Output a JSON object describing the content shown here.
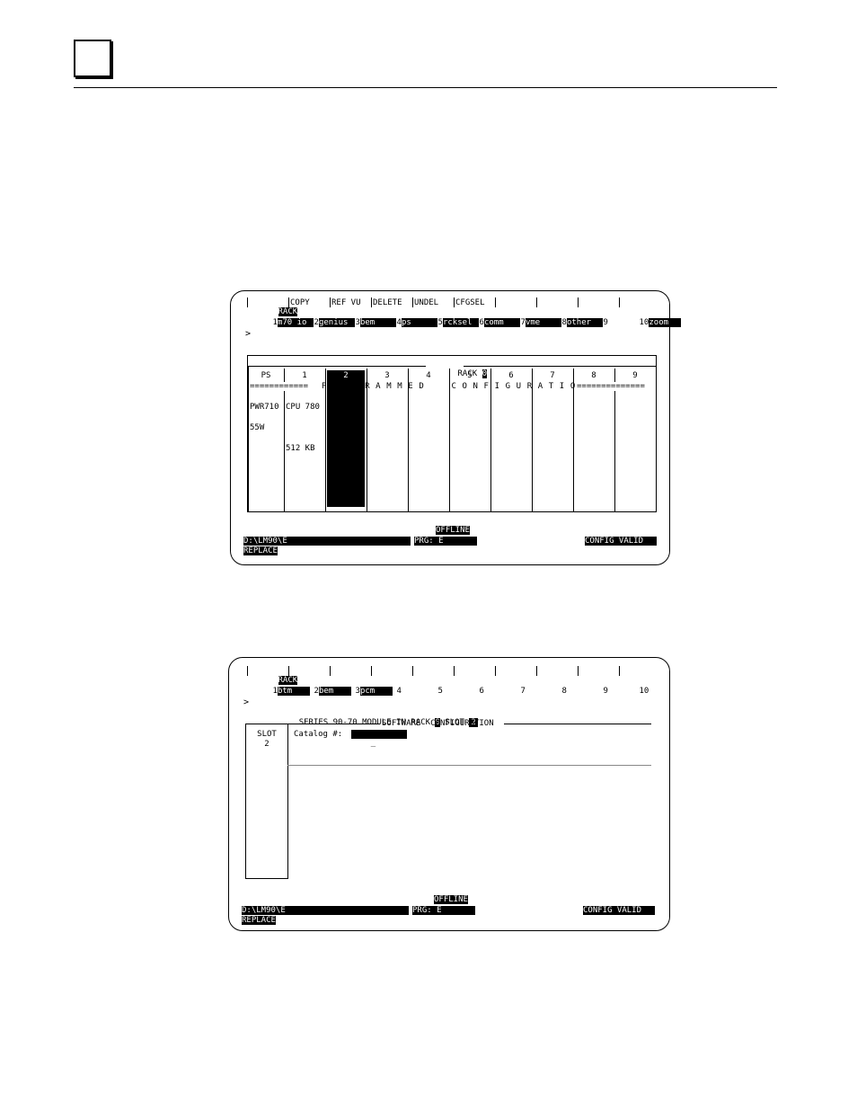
{
  "screen1": {
    "fkeys_top": [
      "RACK",
      "COPY",
      "REF VU",
      "DELETE",
      "UNDEL",
      "CFGSEL",
      "",
      "",
      "",
      ""
    ],
    "fkeys": [
      {
        "num": "1",
        "label": "m70 io"
      },
      {
        "num": "2",
        "label": "genius"
      },
      {
        "num": "3",
        "label": "bem"
      },
      {
        "num": "4",
        "label": "ps"
      },
      {
        "num": "5",
        "label": "rcksel"
      },
      {
        "num": "6",
        "label": "comm"
      },
      {
        "num": "7",
        "label": "vme"
      },
      {
        "num": "8",
        "label": "other"
      },
      {
        "num": "9",
        "label": ""
      },
      {
        "num": "10",
        "label": "zoom"
      }
    ],
    "prompt": ">",
    "rack_title": "RACK",
    "rack_number": "0",
    "slots": [
      "PS",
      "1",
      "2",
      "3",
      "4",
      "5",
      "6",
      "7",
      "8",
      "9"
    ],
    "banner_left": "============",
    "banner_text": "P R O G R A M M E D     C O N F I G U R A T I O N",
    "banner_right": "==============",
    "ps_module": [
      "PWR710",
      "55W"
    ],
    "cpu_module": [
      "CPU 780",
      "512 KB"
    ],
    "status": {
      "mode": "OFFLINE",
      "path": "D:\\LM90\\E",
      "program": "PRG: E",
      "config": "CONFIG VALID",
      "edit_mode": "REPLACE"
    }
  },
  "screen2": {
    "fkeys_top": [
      "RACK",
      "",
      "",
      "",
      "",
      "",
      "",
      "",
      "",
      ""
    ],
    "fkeys": [
      {
        "num": "1",
        "label": "btm"
      },
      {
        "num": "2",
        "label": "bem"
      },
      {
        "num": "3",
        "label": "pcm"
      },
      {
        "num": "4",
        "label": ""
      },
      {
        "num": "5",
        "label": ""
      },
      {
        "num": "6",
        "label": ""
      },
      {
        "num": "7",
        "label": ""
      },
      {
        "num": "8",
        "label": ""
      },
      {
        "num": "9",
        "label": ""
      },
      {
        "num": "10",
        "label": ""
      }
    ],
    "prompt": ">",
    "module_line_prefix": "SERIES 90-70 MODULE IN RACK",
    "rack_number": "0",
    "slot_label": "SLOT",
    "slot_number": "2",
    "panel_title": "SOFTWARE  CONFIGURATION",
    "slot_box_label": "SLOT",
    "slot_box_value": "2",
    "catalog_label": "Catalog #:",
    "catalog_value": "_",
    "status": {
      "mode": "OFFLINE",
      "path": "D:\\LM90\\E",
      "program": "PRG: E",
      "config": "CONFIG VALID",
      "edit_mode": "REPLACE"
    }
  }
}
